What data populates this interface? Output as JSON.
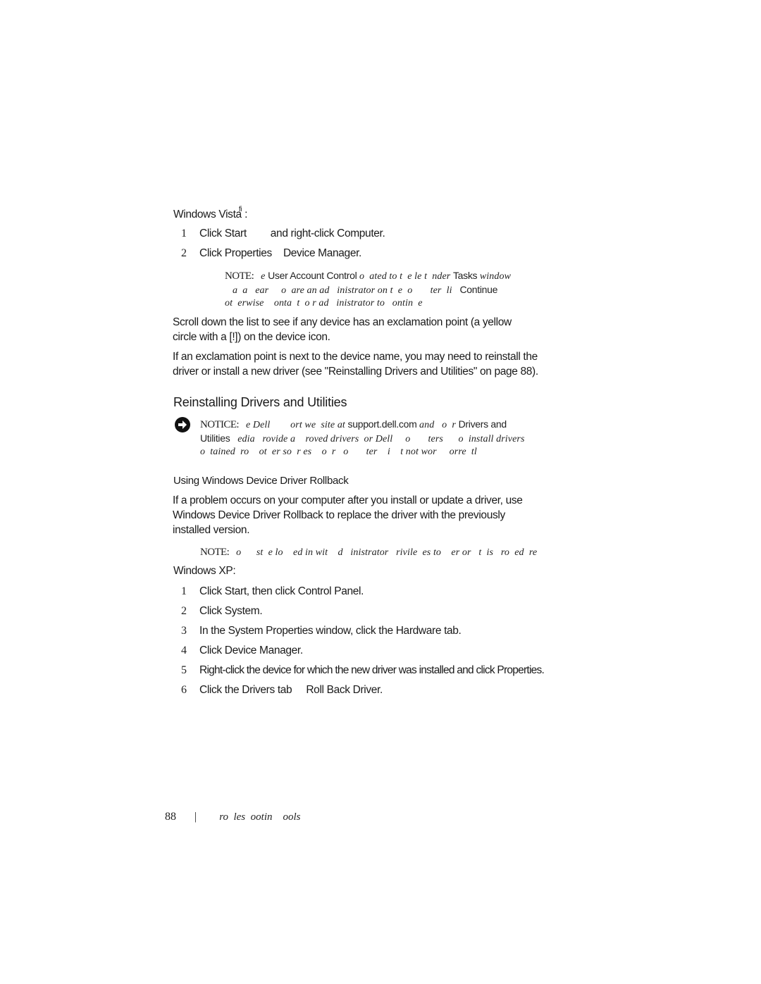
{
  "vista_section": {
    "heading": "Windows Vista",
    "heading_mark": "fi",
    "heading_suffix": " :",
    "steps": [
      {
        "num": "1",
        "parts": [
          "Click Start",
          "and right-click Computer."
        ]
      },
      {
        "num": "2",
        "parts": [
          "Click Properties",
          "Device Manager."
        ]
      }
    ],
    "note": {
      "label": "NOTE:",
      "line1": [
        {
          "t": "e ",
          "style": "it"
        },
        {
          "t": "User Account Control",
          "style": "ui"
        },
        {
          "t": " o  ated to t  e le t  nder ",
          "style": "it"
        },
        {
          "t": "Tasks",
          "style": "ui"
        },
        {
          "t": " window",
          "style": "it"
        }
      ],
      "line2": [
        {
          "t": "a  a   ear     o  are an ad   inistrator on t  e  o       ter  li   ",
          "style": "it"
        },
        {
          "t": "Continue",
          "style": "ui"
        }
      ],
      "line3": [
        {
          "t": "ot  erwise    onta  t  o r ad   inistrator to   ontin  e",
          "style": "it"
        }
      ]
    }
  },
  "paragraphs": {
    "scroll_line1": "Scroll down the list to see if any device has an exclamation point (a yellow",
    "scroll_line2": "circle with a [!]) on the device icon.",
    "exclaim_line1": "If an exclamation point is next to the device name, you may need to reinstall the",
    "exclaim_line2": "driver or install a new driver (see \"Reinstalling Drivers and Utilities\" on page 88)."
  },
  "reinstall_section": {
    "heading": "Reinstalling Drivers and Utilities",
    "notice_icon": "arrow-right-circle-icon",
    "notice": {
      "label": "NOTICE:",
      "line1": [
        {
          "t": "e Dell        ort we  site at ",
          "style": "it"
        },
        {
          "t": "support.dell.com",
          "style": "ui"
        },
        {
          "t": " and   o  r ",
          "style": "it"
        },
        {
          "t": "Drivers and",
          "style": "ui"
        }
      ],
      "line2": [
        {
          "t": "Utilities",
          "style": "ui"
        },
        {
          "t": "   edia   rovide a    roved drivers  or Dell     o       ters      o  install drivers",
          "style": "it"
        }
      ],
      "line3": [
        {
          "t": "o  tained  ro    ot  er so  r es    o  r   o       ter    i    t not wor     orre  tl",
          "style": "it"
        }
      ]
    }
  },
  "rollback_section": {
    "heading": "Using Windows Device Driver Rollback",
    "para_line1": "If a problem occurs on your computer after you install or update a driver, use",
    "para_line2": "Windows Device Driver Rollback to replace the driver with the previously",
    "para_line3": "installed version.",
    "note": {
      "label": "NOTE:",
      "text": "o      st  e lo    ed in wit    d   inistrator   rivile  es to    er or   t  is   ro  ed  re"
    },
    "xp_heading": "Windows XP:",
    "steps": [
      {
        "num": "1",
        "parts": [
          "Click Start, then click Control Panel."
        ]
      },
      {
        "num": "2",
        "parts": [
          "Click System."
        ]
      },
      {
        "num": "3",
        "parts": [
          "In the System Properties window, click the Hardware tab."
        ]
      },
      {
        "num": "4",
        "parts": [
          "Click Device Manager."
        ]
      },
      {
        "num": "5",
        "parts": [
          "Right-click the device for which the new driver was installed and click Properties."
        ]
      },
      {
        "num": "6",
        "parts": [
          "Click the Drivers tab",
          "Roll Back Driver."
        ]
      }
    ]
  },
  "footer": {
    "page_number": "88",
    "separator": "|",
    "chapter_title": "ro  les  ootin    ools"
  }
}
